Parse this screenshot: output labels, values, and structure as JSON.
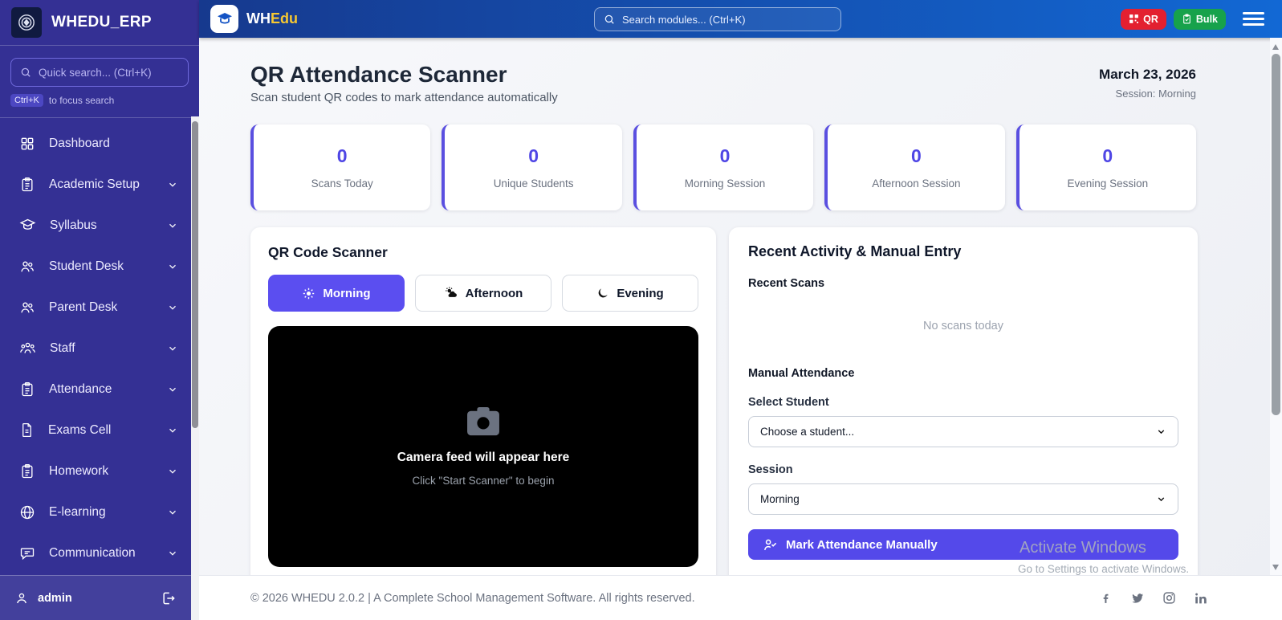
{
  "sidebar": {
    "brand": "WHEDU_ERP",
    "search_placeholder": "Quick search... (Ctrl+K)",
    "shortcut_badge": "Ctrl+K",
    "shortcut_hint": "to focus search",
    "items": [
      {
        "label": "Dashboard",
        "icon": "grid-icon",
        "has_chevron": false
      },
      {
        "label": "Academic Setup",
        "icon": "clipboard-icon",
        "has_chevron": true
      },
      {
        "label": "Syllabus",
        "icon": "graduation-cap-icon",
        "has_chevron": true
      },
      {
        "label": "Student Desk",
        "icon": "users-icon",
        "has_chevron": true
      },
      {
        "label": "Parent Desk",
        "icon": "users-icon",
        "has_chevron": true
      },
      {
        "label": "Staff",
        "icon": "users-group-icon",
        "has_chevron": true
      },
      {
        "label": "Attendance",
        "icon": "clipboard-icon",
        "has_chevron": true
      },
      {
        "label": "Exams Cell",
        "icon": "file-icon",
        "has_chevron": true
      },
      {
        "label": "Homework",
        "icon": "clipboard-icon",
        "has_chevron": true
      },
      {
        "label": "E-learning",
        "icon": "globe-icon",
        "has_chevron": true
      },
      {
        "label": "Communication",
        "icon": "chat-icon",
        "has_chevron": true
      }
    ],
    "user": "admin"
  },
  "navbar": {
    "brand_wh": "WH",
    "brand_edu": "Edu",
    "search_placeholder": "Search modules... (Ctrl+K)",
    "qr_button": "QR",
    "bulk_button": "Bulk"
  },
  "header": {
    "title": "QR Attendance Scanner",
    "subtitle": "Scan student QR codes to mark attendance automatically",
    "date": "March 23, 2026",
    "session": "Session: Morning"
  },
  "stats": [
    {
      "value": "0",
      "label": "Scans Today"
    },
    {
      "value": "0",
      "label": "Unique Students"
    },
    {
      "value": "0",
      "label": "Morning Session"
    },
    {
      "value": "0",
      "label": "Afternoon Session"
    },
    {
      "value": "0",
      "label": "Evening Session"
    }
  ],
  "scanner": {
    "title": "QR Code Scanner",
    "sessions": [
      {
        "label": "Morning",
        "icon": "sun-icon",
        "active": true
      },
      {
        "label": "Afternoon",
        "icon": "cloud-sun-icon",
        "active": false
      },
      {
        "label": "Evening",
        "icon": "moon-icon",
        "active": false
      }
    ],
    "camera_title": "Camera feed will appear here",
    "camera_hint": "Click \"Start Scanner\" to begin"
  },
  "activity": {
    "title": "Recent Activity & Manual Entry",
    "recent_scans_label": "Recent Scans",
    "empty_text": "No scans today",
    "manual_label": "Manual Attendance",
    "student_label": "Select Student",
    "student_value": "Choose a student...",
    "session_label": "Session",
    "session_value": "Morning",
    "mark_button": "Mark Attendance Manually"
  },
  "footer": {
    "copyright": "© 2026 WHEDU 2.0.2 | A Complete School Management Software. All rights reserved.",
    "social": [
      "facebook-icon",
      "twitter-icon",
      "instagram-icon",
      "linkedin-icon"
    ]
  },
  "watermark": {
    "line1": "Activate Windows",
    "line2": "Go to Settings to activate Windows."
  },
  "colors": {
    "sidebar_bg": "#343094",
    "navbar_gradient_start": "#16398e",
    "navbar_gradient_end": "#1268d4",
    "accent_indigo": "#5b4ef0",
    "stat_number": "#4f46e5",
    "qr_button_red": "#e32030",
    "bulk_button_green": "#17a24b",
    "brand_yellow": "#f7c831"
  }
}
